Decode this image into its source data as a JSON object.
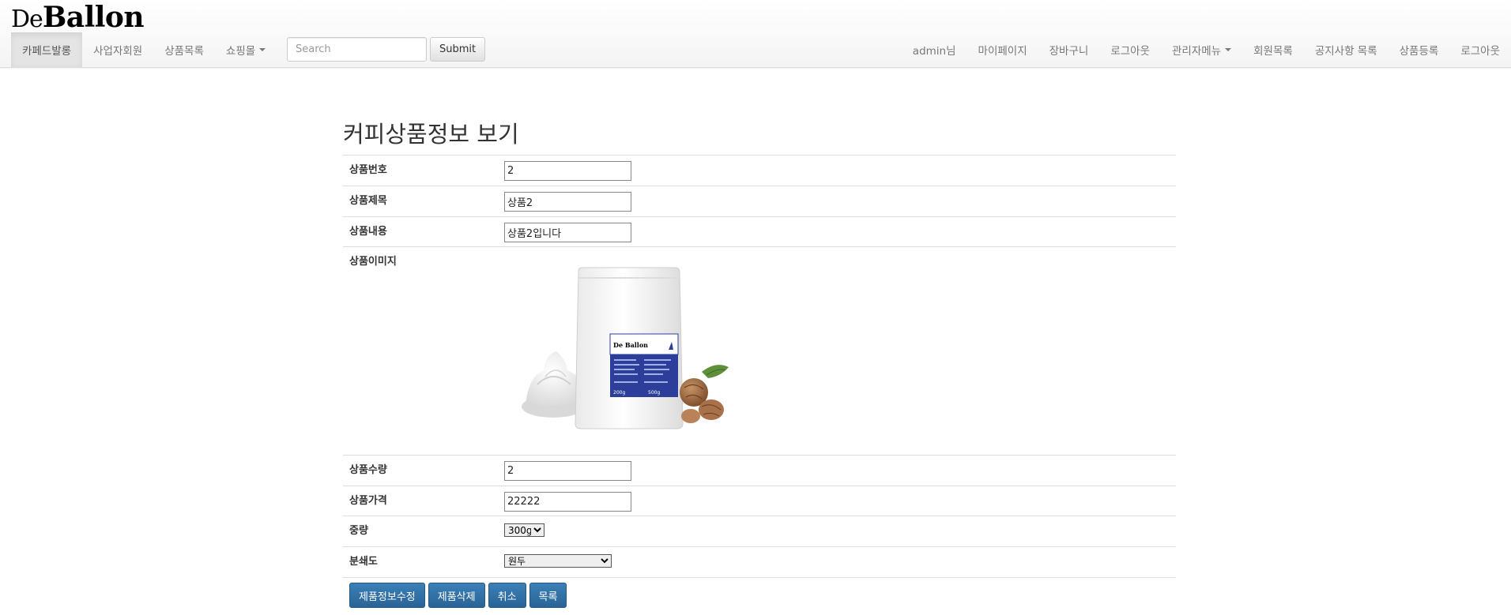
{
  "brand": {
    "prefix": "De",
    "name": "Ballon"
  },
  "nav_left": {
    "items": [
      {
        "label": "카페드발롱"
      },
      {
        "label": "사업자회원"
      },
      {
        "label": "상품목록"
      },
      {
        "label": "쇼핑몰"
      }
    ]
  },
  "search": {
    "placeholder": "Search",
    "value": "",
    "submit_label": "Submit"
  },
  "nav_right": {
    "items": [
      {
        "label": "admin님"
      },
      {
        "label": "마이페이지"
      },
      {
        "label": "장바구니"
      },
      {
        "label": "로그아웃"
      },
      {
        "label": "관리자메뉴"
      },
      {
        "label": "회원목록"
      },
      {
        "label": "공지사항 목록"
      },
      {
        "label": "상품등록"
      },
      {
        "label": "로그아웃"
      }
    ]
  },
  "page_title": "커피상품정보 보기",
  "form": {
    "product_no": {
      "label": "상품번호",
      "value": "2"
    },
    "product_title": {
      "label": "상품제목",
      "value": "상품2"
    },
    "product_content": {
      "label": "상품내용",
      "value": "상품2입니다"
    },
    "product_image": {
      "label": "상품이미지",
      "bag_brand": "De Ballon",
      "bag_weight": "200g"
    },
    "product_qty": {
      "label": "상품수량",
      "value": "2"
    },
    "product_price": {
      "label": "상품가격",
      "value": "22222"
    },
    "weight": {
      "label": "중량",
      "value": "300g"
    },
    "grind": {
      "label": "분쇄도",
      "value": "원두"
    }
  },
  "buttons": {
    "edit": "제품정보수정",
    "delete": "제품삭제",
    "cancel": "취소",
    "list": "목록"
  },
  "colors": {
    "primary_button": "#2a6496",
    "label_blue": "#2c3e9a",
    "navbar_bg": "#f8f8f8"
  }
}
